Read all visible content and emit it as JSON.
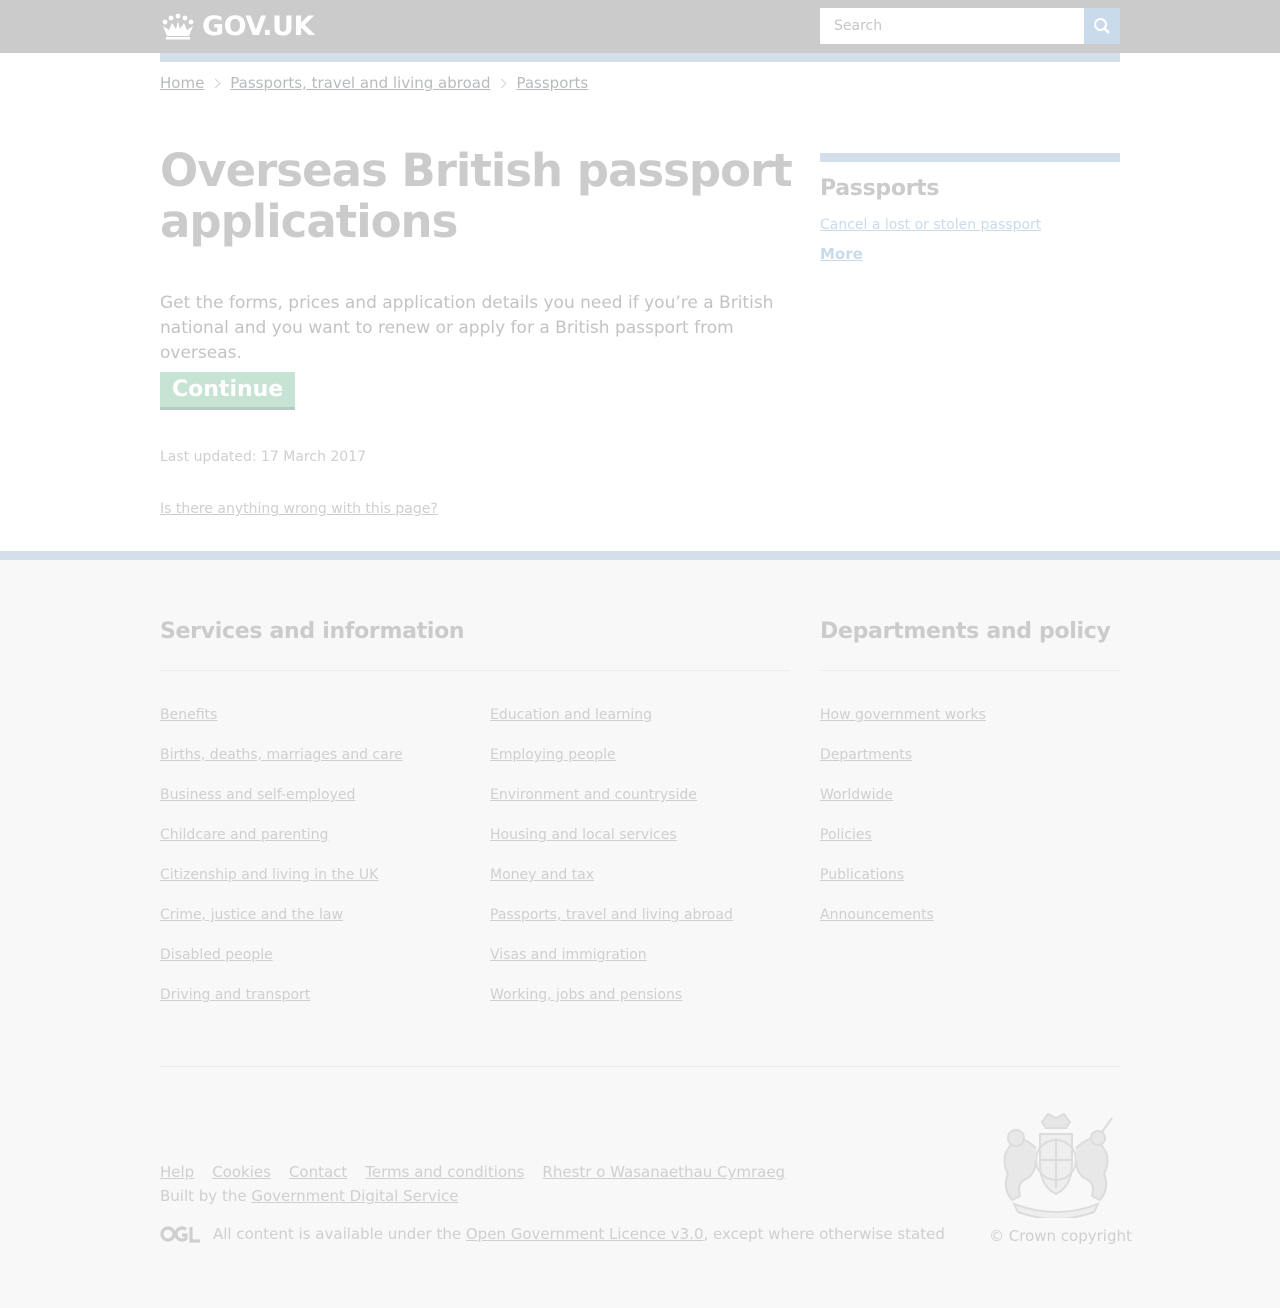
{
  "header": {
    "logo_text": "GOV.UK",
    "search_placeholder": "Search"
  },
  "breadcrumb": [
    "Home",
    "Passports, travel and living abroad",
    "Passports"
  ],
  "main": {
    "title": "Overseas British passport applications",
    "lede": "Get the forms, prices and application details you need if you’re a British national and you want to renew or apply for a British passport from overseas.",
    "continue_label": "Continue",
    "last_updated": "Last updated: 17 March 2017",
    "report_link": "Is there anything wrong with this page?"
  },
  "sidebar": {
    "heading": "Passports",
    "links": [
      "Cancel a lost or stolen passport"
    ],
    "more_label": "More"
  },
  "footer": {
    "services_heading": "Services and information",
    "departments_heading": "Departments and policy",
    "services_col1": [
      "Benefits",
      "Births, deaths, marriages and care",
      "Business and self-employed",
      "Childcare and parenting",
      "Citizenship and living in the UK",
      "Crime, justice and the law",
      "Disabled people",
      "Driving and transport"
    ],
    "services_col2": [
      "Education and learning",
      "Employing people",
      "Environment and countryside",
      "Housing and local services",
      "Money and tax",
      "Passports, travel and living abroad",
      "Visas and immigration",
      "Working, jobs and pensions"
    ],
    "departments": [
      "How government works",
      "Departments",
      "Worldwide",
      "Policies",
      "Publications",
      "Announcements"
    ],
    "meta_links": [
      "Help",
      "Cookies",
      "Contact",
      "Terms and conditions",
      "Rhestr o Wasanaethau Cymraeg"
    ],
    "built_by_prefix": "Built by the ",
    "built_by_link": "Government Digital Service",
    "licence_prefix": "All content is available under the ",
    "licence_link": "Open Government Licence v3.0",
    "licence_suffix": ", except where otherwise stated",
    "copyright": "© Crown copyright"
  },
  "icons": {
    "logo": "crown-icon",
    "search": "search-icon",
    "licence": "ogl-logo",
    "crest": "royal-coat-of-arms"
  }
}
